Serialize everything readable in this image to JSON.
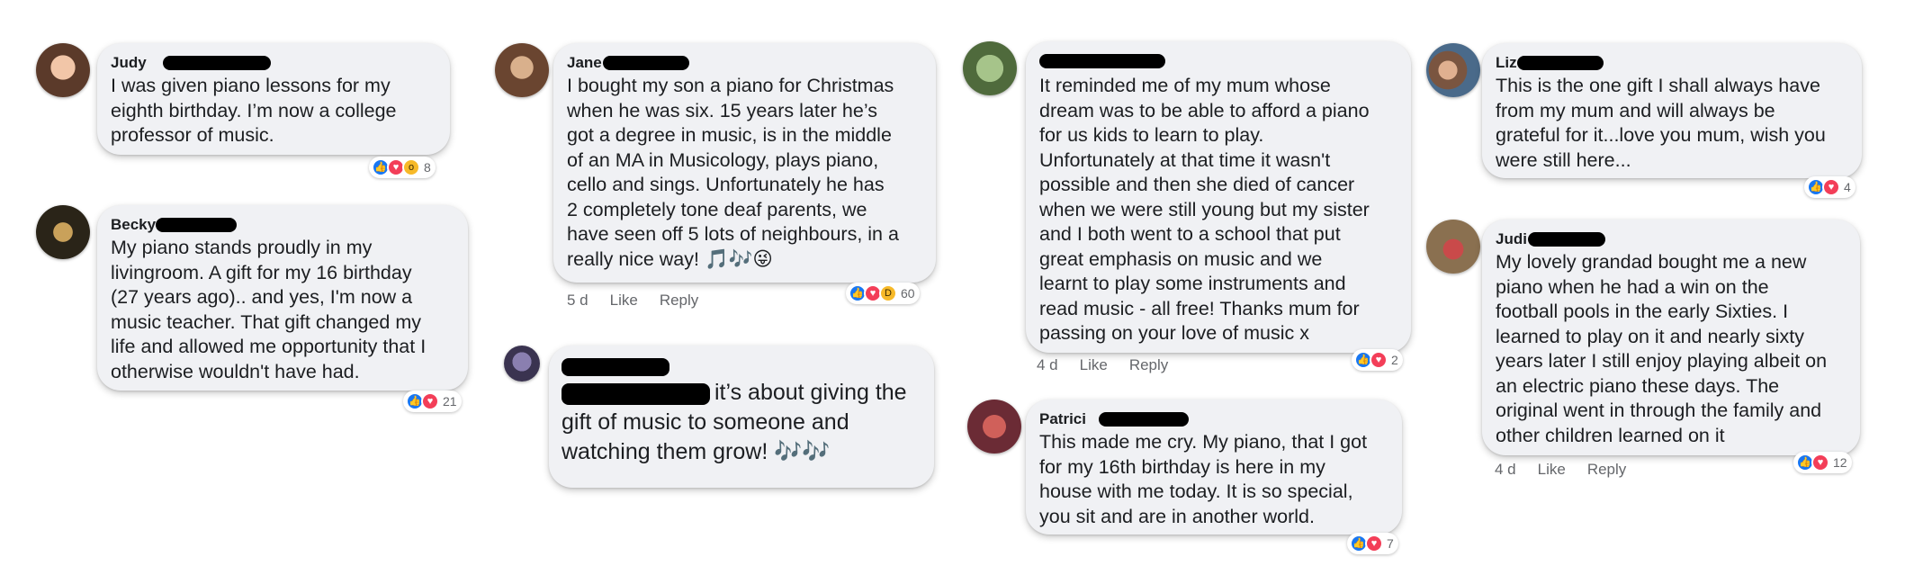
{
  "comments": [
    {
      "name": "Judy",
      "text": "I was given piano lessons for my\neighth birthday. I’m now a college\nprofessor of music.",
      "reaction_count": "8"
    },
    {
      "name": "Becky",
      "text": "My piano stands proudly in my\nlivingroom.   A gift for my 16 birthday\n(27 years ago).. and yes,  I'm now a\nmusic teacher.   That gift changed my\nlife and allowed me opportunity that I\notherwise wouldn't have had.",
      "reaction_count": "21"
    },
    {
      "name": "Jane",
      "text": "I bought my son a piano for Christmas\nwhen he was six. 15 years later he’s\ngot a degree in music, is in the middle\nof an MA in Musicology, plays piano,\ncello and sings. Unfortunately he has\n2 completely tone deaf parents, we\nhave seen off 5 lots of neighbours, in a\nreally nice way! 🎵🎶😜",
      "reaction_count": "60",
      "time": "5 d",
      "like": "Like",
      "reply": "Reply"
    },
    {
      "name": "",
      "text": "it’s about giving the\ngift of music to someone and\nwatching them grow! 🎶🎶"
    },
    {
      "name": "",
      "text": "It reminded me of my mum whose\ndream was to be able to afford a piano\nfor us kids to learn to play.\nUnfortunately at that time it wasn't\npossible and then she died of cancer\nwhen we were still young but my sister\nand I both went to a school that put\ngreat emphasis on music and we\nlearnt to play some instruments and\nread music - all free! Thanks mum for\npassing on your love of music x",
      "reaction_count": "2",
      "time": "4 d",
      "like": "Like",
      "reply": "Reply"
    },
    {
      "name": "Patrici",
      "text": "This made me cry. My piano, that I got\nfor my 16th birthday is here in my\nhouse with me today. It is so special,\nyou sit and are in another world.",
      "reaction_count": "7"
    },
    {
      "name": "Liz",
      "text": "This is the one gift I shall always have\nfrom my mum and will always be\ngrateful for it...love you mum, wish you\nwere still here...",
      "reaction_count": "4"
    },
    {
      "name": "Judi",
      "text": "My lovely grandad bought me a new\npiano when he had a win on the\nfootball pools in the early Sixties.  I\nlearned to play on it and nearly sixty\nyears later I still enjoy playing albeit on\nan electric piano these days.  The\noriginal went in through the family and\nother children learned on it",
      "reaction_count": "12",
      "time": "4 d",
      "like": "Like",
      "reply": "Reply"
    }
  ],
  "reaction_icons": {
    "like": "thumbs-up-icon",
    "love": "heart-icon",
    "wow": "wow-face-icon",
    "haha": "laughing-face-icon"
  },
  "colors": {
    "bubble": "#f0f1f4",
    "like_blue": "#1877f2",
    "love_red": "#f33e58",
    "meta_gray": "#65676b"
  }
}
